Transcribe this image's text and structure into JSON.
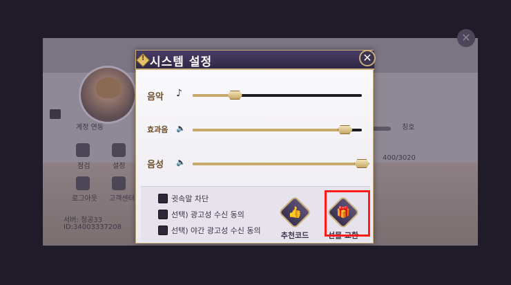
{
  "dialog": {
    "title": "시스템 설정",
    "sliders": [
      {
        "label": "음악",
        "icon": "music-note-icon",
        "value": 0.25
      },
      {
        "label": "효과음",
        "icon": "speaker-icon",
        "value": 0.9
      },
      {
        "label": "음성",
        "icon": "speaker-icon",
        "value": 1.0
      }
    ],
    "options": [
      "귓속말 차단",
      "선택) 광고성 수신 동의",
      "선택) 야간 광고성 수신 동의"
    ],
    "actions": [
      "추천코드",
      "선물 교환"
    ],
    "close_icon": "close-icon"
  },
  "background": {
    "account_link": "계정 연동",
    "icon_label_1": "점검",
    "icon_label_2": "설정",
    "logout": "로그아웃",
    "customer_center": "고객센터",
    "server": "서버: 청공33",
    "user_id": "ID:34003337208",
    "title_label": "칭호",
    "exp": "400/3020"
  },
  "colors": {
    "accent": "#c9b07a",
    "title_bar": "#3b3350",
    "highlight": "#ff1a1a"
  }
}
